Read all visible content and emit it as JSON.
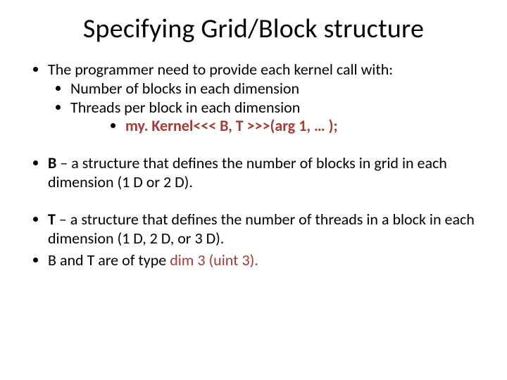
{
  "title": "Specifying Grid/Block structure",
  "b1": "The programmer need to provide each kernel call with:",
  "b1a": "Number of blocks in each dimension",
  "b1b": "Threads per block in each dimension",
  "b1c": "my. Kernel<<< B, T >>>(arg 1, … );",
  "b2_b": "B",
  "b2_rest": " – a structure that defines the number of blocks in grid in each dimension (1 D or 2 D).",
  "b3_t": "T",
  "b3_rest": " – a structure that defines the number of threads in a block in each dimension (1 D, 2 D, or 3 D).",
  "b4_pre": "B and T are of type ",
  "b4_red": "dim 3 (uint 3).",
  "b4_post": ""
}
